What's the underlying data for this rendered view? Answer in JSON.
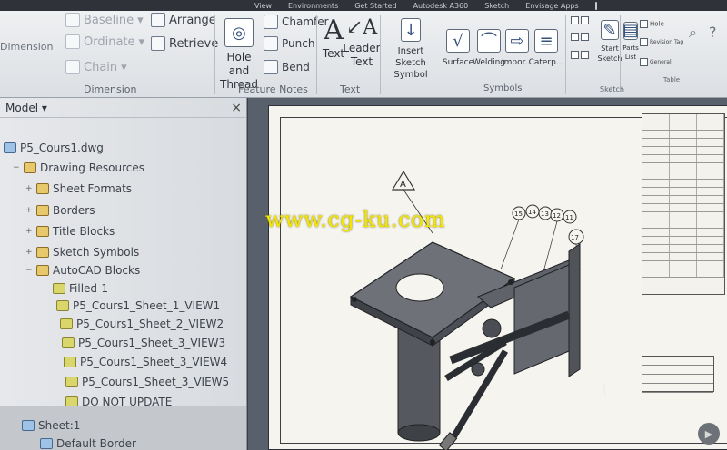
{
  "top_tabs": [
    "View",
    "Environments",
    "Get Started",
    "Autodesk A360",
    "Sketch",
    "Envisage Apps"
  ],
  "ribbon": {
    "dimension_group": {
      "label": "Dimension",
      "big_button": "Dimension",
      "items": [
        "Baseline",
        "Ordinate",
        "Chain"
      ],
      "items_right": [
        "Arrange",
        "Retrieve"
      ]
    },
    "feature_notes_group": {
      "label": "Feature Notes",
      "hole_button_line1": "Hole and",
      "hole_button_line2": "Thread",
      "items": [
        "Chamfer",
        "Punch",
        "Bend"
      ]
    },
    "text_group": {
      "label": "Text",
      "text_button": "Text",
      "leader_line1": "Leader",
      "leader_line2": "Text"
    },
    "symbols_group": {
      "label": "Symbols",
      "insert_line1": "Insert",
      "insert_line2": "Sketch Symbol",
      "items": [
        "Surface",
        "Welding",
        "Impor...",
        "Caterp..."
      ]
    },
    "sketch_group": {
      "label": "Sketch",
      "start_line1": "Start",
      "start_line2": "Sketch"
    },
    "table_group": {
      "label": "Table",
      "parts_line1": "Parts",
      "parts_line2": "List",
      "items": [
        "Hole",
        "Revision Tag",
        "General"
      ]
    }
  },
  "browser": {
    "header": "Model",
    "close": "×",
    "tree": [
      "P5_Cours1.dwg",
      "Drawing Resources",
      "Sheet Formats",
      "Borders",
      "Title Blocks",
      "Sketch Symbols",
      "AutoCAD Blocks",
      "Filled-1",
      "P5_Cours1_Sheet_1_VIEW1",
      "P5_Cours1_Sheet_2_VIEW2",
      "P5_Cours1_Sheet_3_VIEW3",
      "P5_Cours1_Sheet_3_VIEW4",
      "P5_Cours1_Sheet_3_VIEW5",
      "DO NOT UPDATE",
      "Sheet:1",
      "Default Border"
    ]
  },
  "drawing": {
    "balloons": [
      "15",
      "14",
      "13",
      "12",
      "11",
      "17"
    ],
    "datum_label": "A"
  },
  "watermark": "www.cg-ku.com",
  "colors": {
    "ribbon_bg": "#e4e6e9",
    "canvas_bg": "#58606b",
    "watermark": "#f5e600"
  }
}
